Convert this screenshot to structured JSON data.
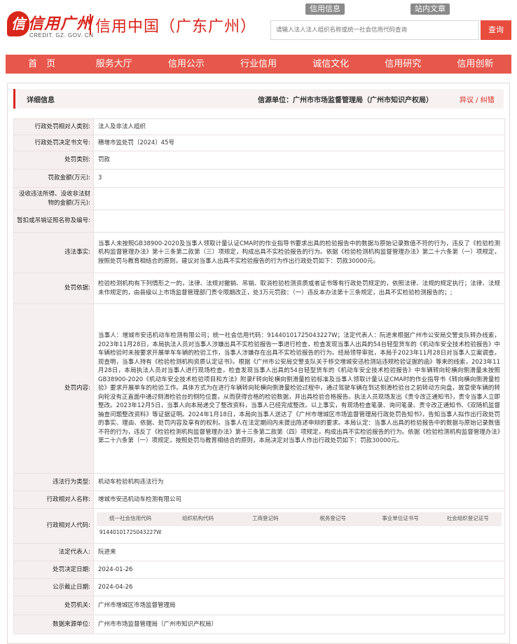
{
  "header": {
    "logo_glyph": "信",
    "logo_text": "信用广州",
    "logo_domain": "CREDIT. GZ. GOV. CN",
    "site_title": "信用中国（广东广州）",
    "links": [
      "信用信息",
      "站内文章"
    ],
    "search": {
      "placeholder": "请输入法人法人组织名称或统一社会信用代码查询",
      "button": "查询"
    }
  },
  "nav": [
    "首　页",
    "服务大厅",
    "信用公示",
    "行业信用",
    "诚信文化",
    "信用研究",
    "信用创新"
  ],
  "detail": {
    "heading": "详细信息",
    "source": "信源单位：广州市市场监督管理局（广州市知识产权局）",
    "objection": "异议 / 纠错"
  },
  "fields": {
    "counterpart_type": {
      "label": "行政处罚相对人类别:",
      "value": "法人及非法人组织"
    },
    "decision_no": {
      "label": "行政处罚决定书文号:",
      "value": "穗增市监处罚〔2024〕45号"
    },
    "penalty_type": {
      "label": "处罚类别:",
      "value": "罚款"
    },
    "fine_amount": {
      "label": "罚款金额(万元):",
      "value": "3"
    },
    "confiscation": {
      "label": "没收违法所得、没收非法财物的金额(万元):",
      "value": ""
    },
    "suspend_license": {
      "label": "暂扣或吊销证照名称及编号:",
      "value": ""
    },
    "illegal_facts": {
      "label": "违法事实:",
      "value": "当事人未按照GB38900-2020及当事人领取计量认证CMA时的作业指导书要求出具的检验报告中的数据与原始记录数值不符的行为，违反了《检验检测机构监督管理办法》第十三条第二款第（三）项规定，构成出具不实检验报告的行为。依据《检验检测机构监督管理办法》第二十六条第（一）项规定，按照处罚与教育相结合的原则，建议对当事人出具不实检验报告的行为作出行政处罚如下：罚款30000元。"
    },
    "penalty_basis": {
      "label": "处罚依据:",
      "value": "检验检测机构有下列情形之一的，法律、法规对撤销、吊销、取消检验检测资质或者证书等有行政处罚规定的，依照法律、法规的规定执行；法律、法规未作规定的，由县级以上市场监督管理部门责令限期改正，处3万元罚款：（一）违反本办法第十三条规定，出具不实检验检测报告的；;"
    },
    "penalty_content": {
      "label": "处罚内容:",
      "value": "当事人：增城市安迅机动车检测有限公司；统一社会信用代码：91440101725043227W；法定代表人：阮进来根据广州市公安局交警支队转办线索，2023年11月28日，本局执法人员对当事人涉嫌出具不实检验报告一事进行检查，检查发现当事人出具的54台轻型货车的《机动车安全技术检验报告》中车辆检验时未按要求开展单车车辆的检验工作，当事人涉嫌存在出具不实检验报告的行为。经局领导审批，本局于2023年11月28日对当事人立案调查。现查明，当事人持有《检验检测机构资质认定证书》。根据《广州市公安局交警支队关于移交增城安迅检测站违规检验证据的函》等来的线索，2023年11月28日，本局执法人员对当事人进行现场检查，检查发现当事人出具的54台轻型货车的《机动车安全技术检验报告》中车辆转向轮横向侧滑量未按照GB38900-2020《机动车安全技术检验项目和方法》附录F转向轮横向侧滑量检验标准及当事人领取计量认证CMA时的作业指导书《转向横向侧滑量检验》要求开展单车的检验工作。具体方式为在进行车辆转向轮横向侧滑量检验过程中，通过驾驶车辆在到达侧滑检验台之前转动方向盘，故意使车辆的转向轮没有正直面中通过侧滑检验台的侧险位置，从而获得合格的检验数据，并出具检验合格报告。执法人员现场发出《责令改正通知书》，责令当事人立即整改。2023年12月5日，当事人向本局递交了整改资料，当事人已经完成整改。以上事实，有现场检查笔录、询问笔录、责令改正通知书、《双随机监督抽查问题整改资料》等证据证明。2024年1月18日，本局向当事人送达了《广州市增城区市场监督管理局行政处罚告知书》，告知当事人拟作出行政处罚的事实、理由、依据、处罚内容及享有的权利。当事人在法定期间内未提出陈述申辩的要求。本局认定：当事人出具的检验报告中的数据与原始记录数值不符的行为，违反了《检验检测机构监督管理办法》第十三条第二款第（四）项规定，构成出具不实检验报告的行为。依据《检验检测机构监督管理办法》第二十六条第（一）项规定，按照处罚与教育相结合的原则，本局决定对当事人作出行政处罚如下：罚款30000元。"
    },
    "violation_type": {
      "label": "违法行为类型:",
      "value": "机动车检验机构违法行为"
    },
    "counterpart_name": {
      "label": "行政相对人名称:",
      "value": "增城市安迅机动车检测有限公司"
    },
    "counterpart_code": {
      "label": "行政相对人代码:",
      "headers": [
        "统一社会信用代码",
        "组织机构代码",
        "工商登记码",
        "税务登记号",
        "事业单位证书号",
        "社会组织登记证号"
      ],
      "values": [
        "91440101725043227W",
        "",
        "",
        "",
        "",
        ""
      ]
    },
    "legal_rep": {
      "label": "法定代表人:",
      "value": "阮进来"
    },
    "decision_date": {
      "label": "处罚决定日期:",
      "value": "2024-01-26"
    },
    "publish_deadline": {
      "label": "公示截止日期:",
      "value": "2024-04-26"
    },
    "penalty_agency": {
      "label": "处罚机关:",
      "value": "广州市增城区市场监督管理局"
    },
    "data_source": {
      "label": "数据来源单位:",
      "value": "广州市市场监督管理局（广州市知识产权局）"
    }
  },
  "colors": {
    "brand_red": "#d9261c",
    "nav_bg": "#e8574b",
    "key_bg": "#f5f0ef"
  }
}
